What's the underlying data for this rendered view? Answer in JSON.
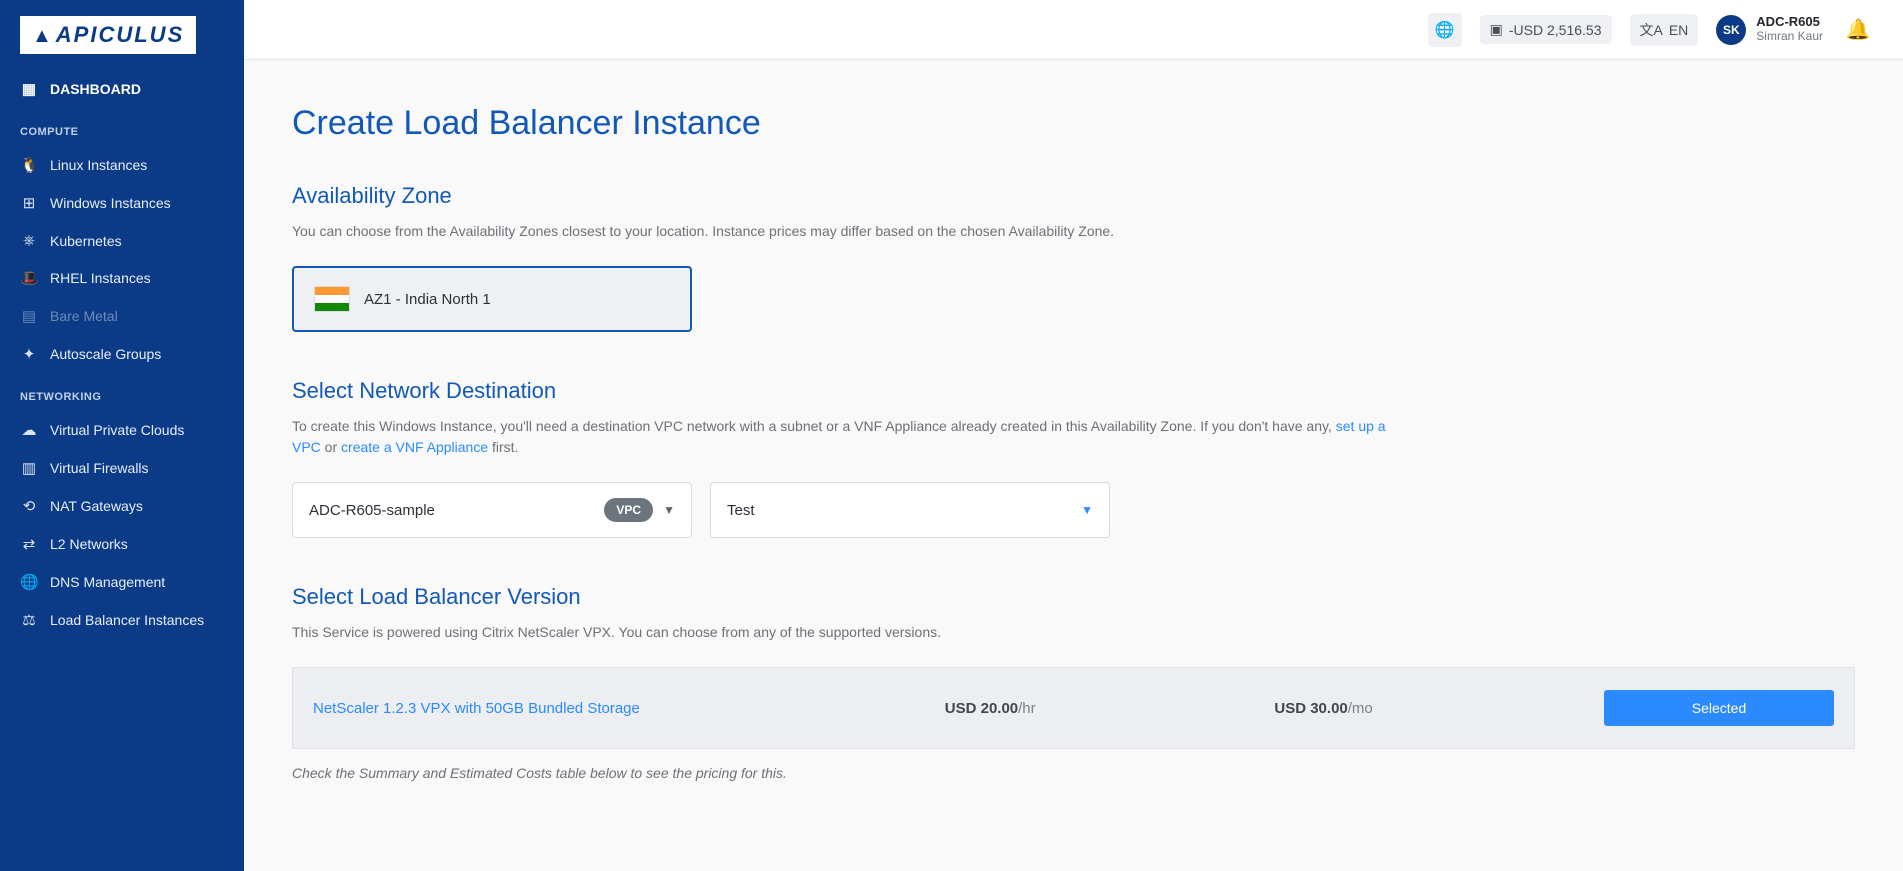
{
  "brand": "APICULUS",
  "header": {
    "balance": "-USD 2,516.53",
    "lang": "EN",
    "user_initials": "SK",
    "user_code": "ADC-R605",
    "user_name": "Simran Kaur"
  },
  "sidebar": {
    "dashboard": "DASHBOARD",
    "sections": {
      "compute": "COMPUTE",
      "networking": "NETWORKING"
    },
    "items": {
      "linux": "Linux Instances",
      "windows": "Windows Instances",
      "kubernetes": "Kubernetes",
      "rhel": "RHEL Instances",
      "bare_metal": "Bare Metal",
      "autoscale": "Autoscale Groups",
      "vpc": "Virtual Private Clouds",
      "vfw": "Virtual Firewalls",
      "nat": "NAT Gateways",
      "l2": "L2 Networks",
      "dns": "DNS Management",
      "lb": "Load Balancer Instances"
    }
  },
  "page": {
    "title": "Create Load Balancer Instance",
    "az": {
      "heading": "Availability Zone",
      "desc": "You can choose from the Availability Zones closest to your location. Instance prices may differ based on the chosen Availability Zone.",
      "selected": "AZ1 - India North 1"
    },
    "network": {
      "heading": "Select Network Destination",
      "desc_pre": "To create this Windows Instance, you'll need a destination VPC network with a subnet or a VNF Appliance already created in this Availability Zone. If you don't have any, ",
      "link_vpc": "set up a VPC",
      "desc_mid": " or ",
      "link_vnf": "create a VNF Appliance",
      "desc_post": " first.",
      "vpc_value": "ADC-R605-sample",
      "vpc_badge": "VPC",
      "tier_value": "Test"
    },
    "version": {
      "heading": "Select Load Balancer Version",
      "desc": "This Service is powered using Citrix NetScaler VPX. You can choose from any of the supported versions.",
      "row": {
        "name": "NetScaler 1.2.3 VPX with 50GB Bundled Storage",
        "price_hr_val": "USD 20.00",
        "price_hr_unit": "/hr",
        "price_mo_val": "USD 30.00",
        "price_mo_unit": "/mo",
        "button": "Selected"
      },
      "note": "Check the Summary and Estimated Costs table below to see the pricing for this."
    }
  }
}
